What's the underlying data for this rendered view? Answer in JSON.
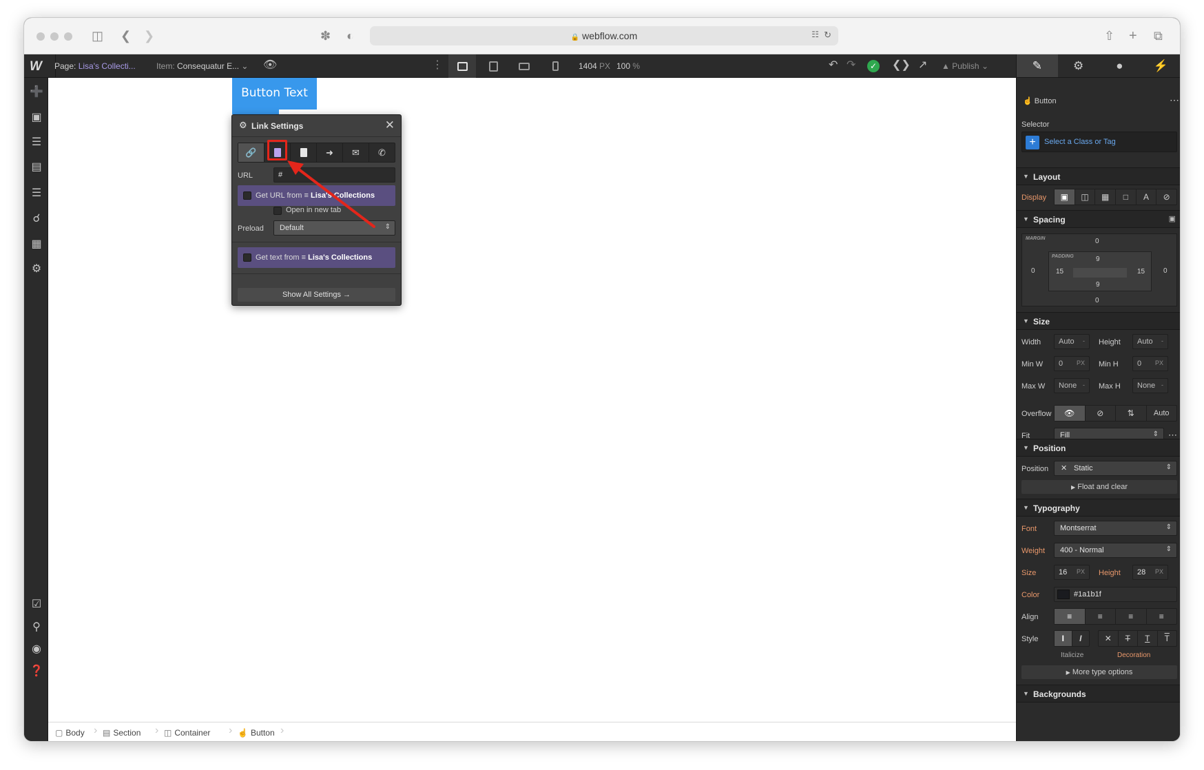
{
  "browser": {
    "url": "webflow.com"
  },
  "topbar": {
    "page_label": "Page:",
    "page_value": "Lisa's Collecti...",
    "item_label": "Item:",
    "item_value": "Consequatur E...",
    "width_value": "1404",
    "width_unit": "PX",
    "zoom_value": "100",
    "zoom_unit": "%",
    "publish_label": "Publish"
  },
  "canvas": {
    "button_text": "Button Text"
  },
  "link_settings": {
    "title": "Link Settings",
    "tabs": [
      "url-link-icon",
      "page-icon",
      "collection-page-icon",
      "page-section-icon",
      "email-icon",
      "phone-icon"
    ],
    "active_tab": "collection-page-icon",
    "url_label": "URL",
    "url_value": "#",
    "get_url_prefix": "Get URL from",
    "get_url_source": "Lisa's Collections",
    "open_new_tab": "Open in new tab",
    "preload_label": "Preload",
    "preload_value": "Default",
    "get_text_prefix": "Get text from",
    "get_text_source": "Lisa's Collections",
    "show_all": "Show All Settings"
  },
  "breadcrumbs": [
    "Body",
    "Section",
    "Container",
    "Button"
  ],
  "right_panel": {
    "element_name": "Button",
    "selector_label": "Selector",
    "selector_placeholder": "Select a Class or Tag",
    "layout": {
      "title": "Layout",
      "display_label": "Display"
    },
    "spacing": {
      "title": "Spacing",
      "margin_label": "MARGIN",
      "padding_label": "PADDING",
      "margin_top": "0",
      "margin_right": "0",
      "margin_bottom": "0",
      "margin_left": "0",
      "padding_top": "9",
      "padding_right": "15",
      "padding_bottom": "9",
      "padding_left": "15"
    },
    "size": {
      "title": "Size",
      "width_label": "Width",
      "width_value": "Auto",
      "height_label": "Height",
      "height_value": "Auto",
      "minw_label": "Min W",
      "minw_value": "0",
      "minh_label": "Min H",
      "minh_value": "0",
      "maxw_label": "Max W",
      "maxw_value": "None",
      "maxh_label": "Max H",
      "maxh_value": "None",
      "unit_px": "PX",
      "unit_dash": "-",
      "overflow_label": "Overflow",
      "overflow_auto": "Auto",
      "fit_label": "Fit",
      "fit_value": "Fill"
    },
    "position": {
      "title": "Position",
      "position_label": "Position",
      "position_value": "Static",
      "float_label": "Float and clear"
    },
    "typography": {
      "title": "Typography",
      "font_label": "Font",
      "font_value": "Montserrat",
      "weight_label": "Weight",
      "weight_value": "400 - Normal",
      "size_label": "Size",
      "size_value": "16",
      "height_label": "Height",
      "height_value": "28",
      "unit_px": "PX",
      "color_label": "Color",
      "color_value": "#1a1b1f",
      "align_label": "Align",
      "style_label": "Style",
      "italicize_label": "Italicize",
      "decoration_label": "Decoration",
      "more_label": "More type options"
    },
    "backgrounds": {
      "title": "Backgrounds"
    }
  },
  "colors": {
    "accent_blue": "#3898ec",
    "cms_purple": "#5a4f80",
    "highlight_red": "#e3261b",
    "success_green": "#2fa84f",
    "text_orange": "#e9986b"
  }
}
